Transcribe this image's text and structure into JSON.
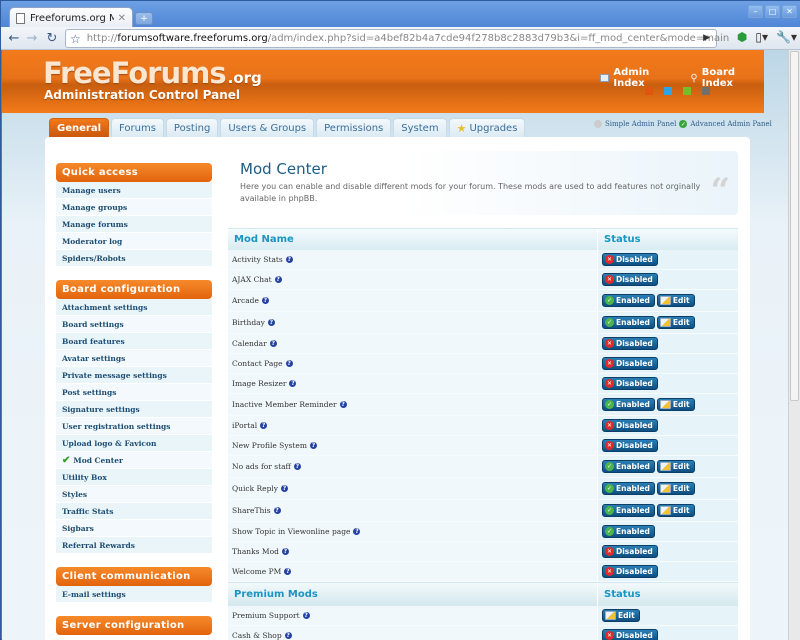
{
  "browser": {
    "tab_title": "Freeforums.org Mod ...",
    "url_scheme": "http://",
    "url_host": "forumsoftware.freeforums.org",
    "url_rest": "/adm/index.php?sid=a4bef82b4a7cde94f278b8c2883d79b3&i=ff_mod_center&mode=main"
  },
  "header": {
    "logo_main": "FreeForums",
    "logo_org": ".org",
    "logo_sub": "Administration Control Panel",
    "links": [
      {
        "label": "Admin Index",
        "icon": "monitor-icon"
      },
      {
        "label": "Board Index",
        "icon": "magnifier-icon"
      }
    ],
    "swatches": [
      "#e0560f",
      "#2ea3e6",
      "#72bf2a",
      "#707070"
    ]
  },
  "tabs": [
    {
      "label": "General",
      "active": true
    },
    {
      "label": "Forums"
    },
    {
      "label": "Posting"
    },
    {
      "label": "Users & Groups"
    },
    {
      "label": "Permissions"
    },
    {
      "label": "System"
    },
    {
      "label": "Upgrades",
      "icon": "star-icon"
    }
  ],
  "panel_switch": {
    "simple": "Simple Admin Panel",
    "advanced": "Advanced Admin Panel"
  },
  "sidebar": [
    {
      "title": "Quick access",
      "items": [
        "Manage users",
        "Manage groups",
        "Manage forums",
        "Moderator log",
        "Spiders/Robots"
      ]
    },
    {
      "title": "Board configuration",
      "items": [
        "Attachment settings",
        "Board settings",
        "Board features",
        "Avatar settings",
        "Private message settings",
        "Post settings",
        "Signature settings",
        "User registration settings",
        "Upload logo & Favicon",
        "Mod Center",
        "Utility Box",
        "Styles",
        "Traffic Stats",
        "Sigbars",
        "Referral Rewards"
      ],
      "active": "Mod Center"
    },
    {
      "title": "Client communication",
      "items": [
        "E-mail settings"
      ]
    },
    {
      "title": "Server configuration",
      "items": []
    }
  ],
  "main": {
    "title": "Mod Center",
    "description": "Here you can enable and disable different mods for your forum. These mods are used to add features not orginally available in phpBB.",
    "col_name": "Mod Name",
    "col_status": "Status",
    "labels": {
      "enabled": "Enabled",
      "disabled": "Disabled",
      "edit": "Edit"
    },
    "mods": [
      {
        "name": "Activity Stats",
        "status": "disabled",
        "edit": false
      },
      {
        "name": "AJAX Chat",
        "status": "disabled",
        "edit": false
      },
      {
        "name": "Arcade",
        "status": "enabled",
        "edit": true
      },
      {
        "name": "Birthday",
        "status": "enabled",
        "edit": true
      },
      {
        "name": "Calendar",
        "status": "disabled",
        "edit": false
      },
      {
        "name": "Contact Page",
        "status": "disabled",
        "edit": false
      },
      {
        "name": "Image Resizer",
        "status": "disabled",
        "edit": false
      },
      {
        "name": "Inactive Member Reminder",
        "status": "enabled",
        "edit": true
      },
      {
        "name": "iPortal",
        "status": "disabled",
        "edit": false
      },
      {
        "name": "New Profile System",
        "status": "disabled",
        "edit": false
      },
      {
        "name": "No ads for staff",
        "status": "enabled",
        "edit": true
      },
      {
        "name": "Quick Reply",
        "status": "enabled",
        "edit": true
      },
      {
        "name": "ShareThis",
        "status": "enabled",
        "edit": true
      },
      {
        "name": "Show Topic in Viewonline page",
        "status": "enabled",
        "edit": false
      },
      {
        "name": "Thanks Mod",
        "status": "disabled",
        "edit": false
      },
      {
        "name": "Welcome PM",
        "status": "disabled",
        "edit": false
      }
    ],
    "premium_title": "Premium Mods",
    "premium_status": "Status",
    "premium": [
      {
        "name": "Premium Support",
        "status": null,
        "edit": true
      },
      {
        "name": "Cash & Shop",
        "status": "disabled",
        "edit": false
      }
    ]
  }
}
